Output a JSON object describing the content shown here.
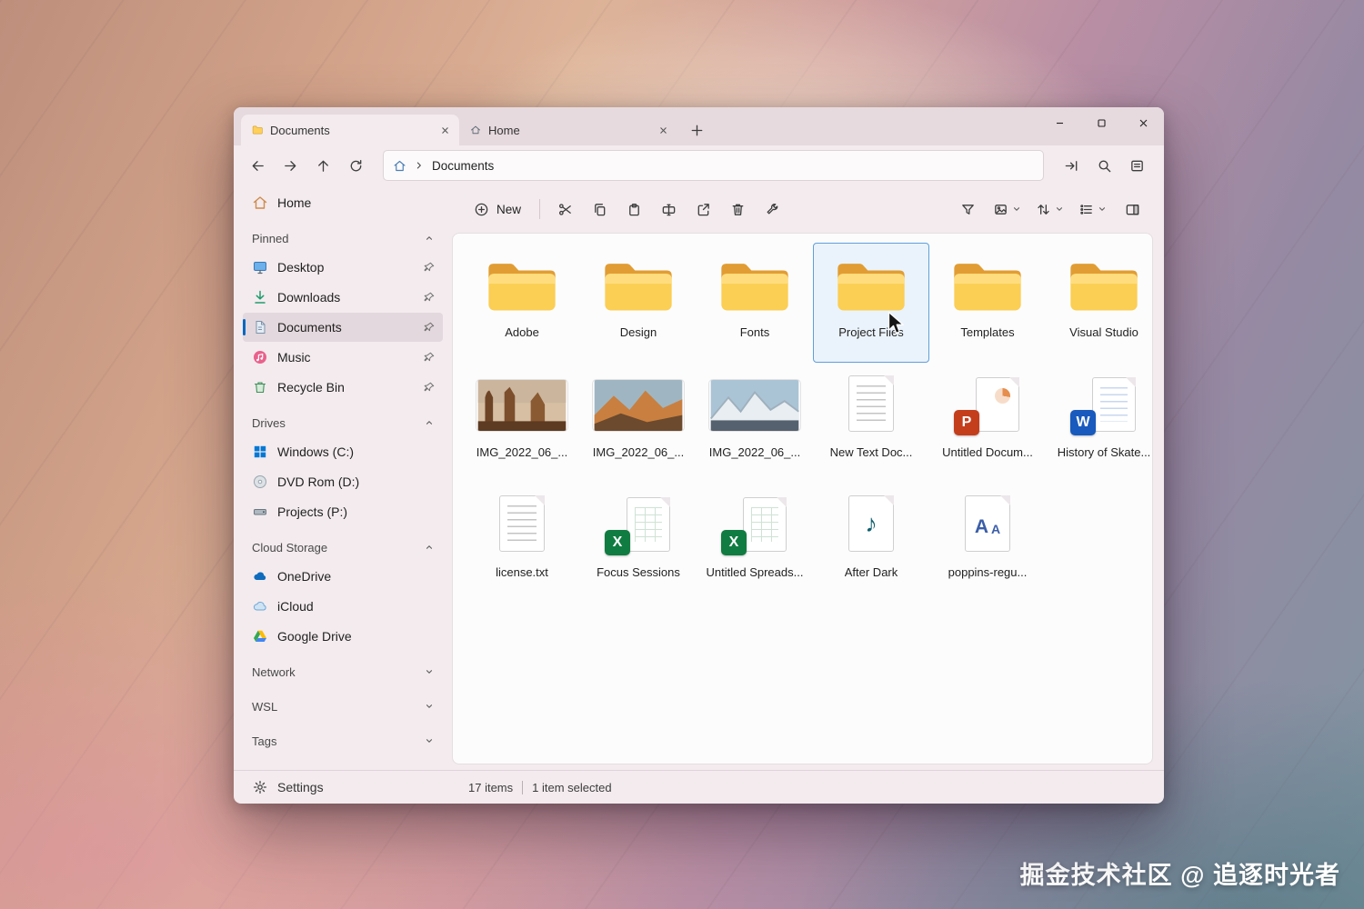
{
  "wallpaper": {
    "watermark": "掘金技术社区 @ 追逐时光者"
  },
  "tabs": {
    "items": [
      {
        "label": "Documents",
        "active": true
      },
      {
        "label": "Home",
        "active": false
      }
    ]
  },
  "address": {
    "path": "Documents"
  },
  "command_bar": {
    "new_label": "New"
  },
  "icons": {
    "nav": [
      "back-icon",
      "forward-icon",
      "up-icon",
      "refresh-icon"
    ],
    "address": [
      "home-icon",
      "chevron-right-icon",
      "jump-to-icon",
      "search-icon",
      "details-icon"
    ],
    "commands": [
      "new-icon",
      "cut-icon",
      "copy-icon",
      "paste-icon",
      "rename-icon",
      "share-icon",
      "delete-icon",
      "properties-icon"
    ],
    "view": [
      "filter-icon",
      "view-mode-icon",
      "sort-icon",
      "group-icon",
      "preview-pane-icon"
    ]
  },
  "sidebar": {
    "home_label": "Home",
    "sections": [
      {
        "label": "Pinned",
        "expanded": true
      },
      {
        "label": "Drives",
        "expanded": true
      },
      {
        "label": "Cloud Storage",
        "expanded": true
      },
      {
        "label": "Network",
        "expanded": false
      },
      {
        "label": "WSL",
        "expanded": false
      },
      {
        "label": "Tags",
        "expanded": false
      }
    ],
    "pinned": [
      {
        "label": "Desktop"
      },
      {
        "label": "Downloads"
      },
      {
        "label": "Documents",
        "selected": true
      },
      {
        "label": "Music"
      },
      {
        "label": "Recycle Bin"
      }
    ],
    "drives": [
      {
        "label": "Windows (C:)"
      },
      {
        "label": "DVD Rom (D:)"
      },
      {
        "label": "Projects (P:)"
      }
    ],
    "cloud": [
      {
        "label": "OneDrive"
      },
      {
        "label": "iCloud"
      },
      {
        "label": "Google Drive"
      }
    ],
    "settings_label": "Settings"
  },
  "files": [
    {
      "name": "Adobe",
      "type": "folder"
    },
    {
      "name": "Design",
      "type": "folder"
    },
    {
      "name": "Fonts",
      "type": "folder"
    },
    {
      "name": "Project Files",
      "type": "folder",
      "selected": true
    },
    {
      "name": "Templates",
      "type": "folder"
    },
    {
      "name": "Visual Studio",
      "type": "folder"
    },
    {
      "name": "IMG_2022_06_...",
      "type": "image"
    },
    {
      "name": "IMG_2022_06_...",
      "type": "image"
    },
    {
      "name": "IMG_2022_06_...",
      "type": "image"
    },
    {
      "name": "New Text Doc...",
      "type": "text"
    },
    {
      "name": "Untitled Docum...",
      "type": "powerpoint"
    },
    {
      "name": "History of Skate...",
      "type": "word"
    },
    {
      "name": "license.txt",
      "type": "text"
    },
    {
      "name": "Focus Sessions",
      "type": "excel"
    },
    {
      "name": "Untitled Spreads...",
      "type": "excel"
    },
    {
      "name": "After Dark",
      "type": "audio"
    },
    {
      "name": "poppins-regu...",
      "type": "font"
    }
  ],
  "status_bar": {
    "items_count": "17 items",
    "selected_count": "1 item selected"
  },
  "colors": {
    "accent": "#0067c0",
    "selection_border": "#5f9fda",
    "selection_fill": "#eaf3fb",
    "folder_front": "#fbce54",
    "folder_back": "#e19d33",
    "word_blue": "#185abd",
    "excel_green": "#107c41",
    "powerpoint_orange": "#c43e1c"
  }
}
